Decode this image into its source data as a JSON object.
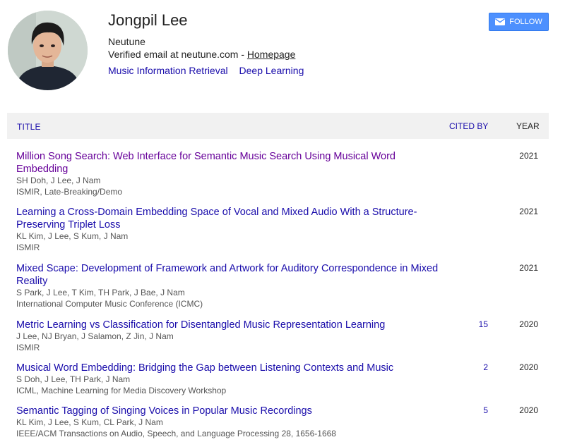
{
  "profile": {
    "name": "Jongpil Lee",
    "affiliation": "Neutune",
    "email_text": "Verified email at neutune.com - ",
    "homepage_label": "Homepage",
    "interests": [
      "Music Information Retrieval",
      "Deep Learning"
    ],
    "follow_label": "FOLLOW"
  },
  "table": {
    "col_title": "TITLE",
    "col_cited": "CITED BY",
    "col_year": "YEAR",
    "rows": [
      {
        "title": "Million Song Search: Web Interface for Semantic Music Search Using Musical Word Embedding",
        "authors": "SH Doh, J Lee, J Nam",
        "venue": "ISMIR, Late-Breaking/Demo",
        "cited": "",
        "year": "2021"
      },
      {
        "title": "Learning a Cross-Domain Embedding Space of Vocal and Mixed Audio With a Structure-Preserving Triplet Loss",
        "authors": "KL Kim, J Lee, S Kum, J Nam",
        "venue": "ISMIR",
        "cited": "",
        "year": "2021"
      },
      {
        "title": "Mixed Scape: Development of Framework and Artwork for Auditory Correspondence in Mixed Reality",
        "authors": "S Park, J Lee, T Kim, TH Park, J Bae, J Nam",
        "venue": "International Computer Music Conference (ICMC)",
        "cited": "",
        "year": "2021"
      },
      {
        "title": "Metric Learning vs Classification for Disentangled Music Representation Learning",
        "authors": "J Lee, NJ Bryan, J Salamon, Z Jin, J Nam",
        "venue": "ISMIR",
        "cited": "15",
        "year": "2020"
      },
      {
        "title": "Musical Word Embedding: Bridging the Gap between Listening Contexts and Music",
        "authors": "S Doh, J Lee, TH Park, J Nam",
        "venue": "ICML, Machine Learning for Media Discovery Workshop",
        "cited": "2",
        "year": "2020"
      },
      {
        "title": "Semantic Tagging of Singing Voices in Popular Music Recordings",
        "authors": "KL Kim, J Lee, S Kum, CL Park, J Nam",
        "venue": "IEEE/ACM Transactions on Audio, Speech, and Language Processing 28, 1656-1668",
        "cited": "5",
        "year": "2020"
      }
    ]
  },
  "colors": {
    "link": "#1a0dab",
    "visited": "#660099",
    "follow_bg": "#4d90fe",
    "header_bg": "#f1f1f1"
  }
}
